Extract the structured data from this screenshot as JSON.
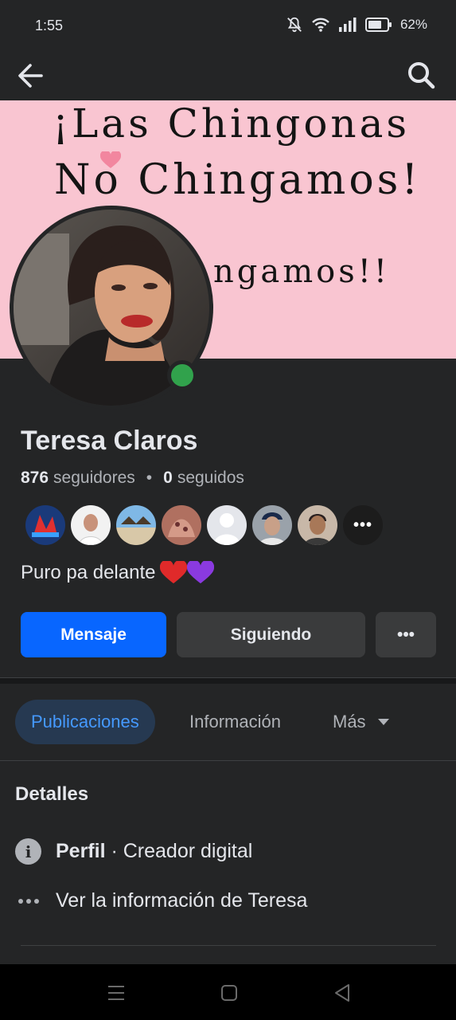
{
  "status_bar": {
    "time": "1:55",
    "battery": "62%"
  },
  "icons": {
    "back": "arrow-left-icon",
    "search": "search-icon",
    "mute": "bell-off-icon",
    "wifi": "wifi-icon",
    "signal": "signal-icon",
    "battery": "battery-icon"
  },
  "cover": {
    "line1": "¡Las Chingonas",
    "line2": "No Chingamos!",
    "line3": "ngamos!!"
  },
  "profile": {
    "name": "Teresa Claros",
    "followers_count": "876",
    "followers_label": "seguidores",
    "following_count": "0",
    "following_label": "seguidos",
    "bio": "Puro pa delante",
    "online": true
  },
  "friends_more": "•••",
  "actions": {
    "message": "Mensaje",
    "following": "Siguiendo",
    "more": "•••"
  },
  "tabs": {
    "posts": "Publicaciones",
    "info": "Información",
    "more": "Más"
  },
  "details": {
    "title": "Detalles",
    "profile_label": "Perfil",
    "profile_type": " · Creador digital",
    "see_info": "Ver la información de Teresa"
  },
  "colors": {
    "accent": "#0866ff",
    "online": "#31a24c",
    "cover_bg": "#f9c5d1",
    "tab_active_bg": "#263951"
  }
}
